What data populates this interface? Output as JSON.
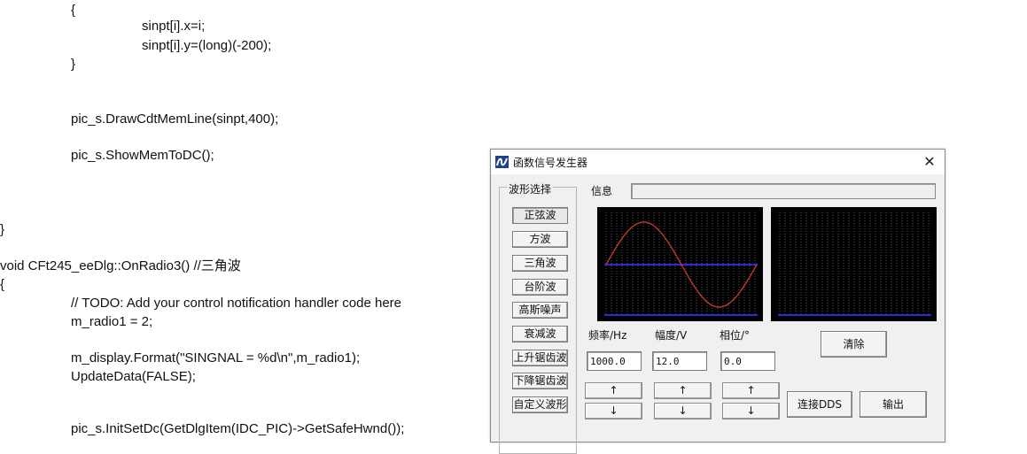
{
  "code": {
    "lines": [
      "{",
      "sinpt[i].x=i;",
      "sinpt[i].y=(long)(-200);",
      "}",
      "pic_s.DrawCdtMemLine(sinpt,400);",
      "pic_s.ShowMemToDC();",
      "}",
      "void CFt245_eeDlg::OnRadio3() //三角波",
      "{",
      "// TODO: Add your control notification handler code here",
      "m_radio1 = 2;",
      "m_display.Format(\"SINGNAL = %d\\n\",m_radio1);",
      "UpdateData(FALSE);",
      "pic_s.InitSetDc(GetDlgItem(IDC_PIC)->GetSafeHwnd());"
    ]
  },
  "dialog": {
    "title": "函数信号发生器",
    "close_glyph": "✕",
    "group_label": "波形选择",
    "waveforms": [
      "正弦波",
      "方波",
      "三角波",
      "台阶波",
      "高斯噪声",
      "衰减波",
      "上升锯齿波",
      "下降锯齿波",
      "自定义波形"
    ],
    "selected_waveform": "正弦波",
    "info_label": "信息",
    "info_value": "",
    "freq_label": "频率/Hz",
    "amp_label": "幅度/V",
    "phase_label": "相位/°",
    "freq_value": "1000.0",
    "amp_value": "12.0",
    "phase_value": "0.0",
    "up_glyph": "↑",
    "down_glyph": "↓",
    "clear_label": "清除",
    "connect_label": "连接DDS",
    "output_label": "输出"
  },
  "colors": {
    "scope_bg": "#000000",
    "grid_dot": "#8a8a8a",
    "axis": "#2a2ad0",
    "sine": "#c0392b"
  },
  "icons": {
    "app": "app-logo-icon",
    "close": "close-icon",
    "up": "arrow-up-icon",
    "down": "arrow-down-icon"
  }
}
